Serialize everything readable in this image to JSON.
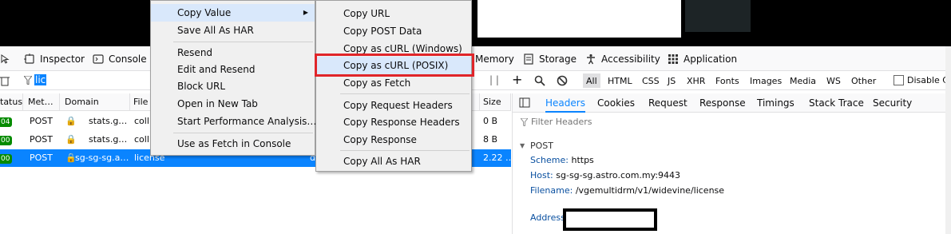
{
  "toolbar": {
    "tabs": [
      {
        "label": "Inspector",
        "icon": "inspector-icon"
      },
      {
        "label": "Console",
        "icon": "console-icon"
      },
      {
        "label": "Memory",
        "icon": "memory-icon"
      },
      {
        "label": "Storage",
        "icon": "storage-icon"
      },
      {
        "label": "Accessibility",
        "icon": "accessibility-icon"
      },
      {
        "label": "Application",
        "icon": "application-icon"
      }
    ]
  },
  "filter": {
    "value": "lic",
    "types": [
      "All",
      "HTML",
      "CSS",
      "JS",
      "XHR",
      "Fonts",
      "Images",
      "Media",
      "WS",
      "Other"
    ],
    "active_type": "All",
    "disable_cache_label": "Disable Ca"
  },
  "table": {
    "columns": [
      "tatus",
      "Met…",
      "Domain",
      "File",
      "Size"
    ],
    "rows": [
      {
        "status": "04",
        "method": "POST",
        "domain": "stats.g…",
        "file": "coll",
        "size": "0 B"
      },
      {
        "status": "00",
        "method": "POST",
        "domain": "stats.g…",
        "file": "coll",
        "size": "8 B"
      },
      {
        "status": "00",
        "method": "POST",
        "domain": "sg-sg-sg.a…",
        "file": "license",
        "extra": "d",
        "size": "2.22 …"
      }
    ]
  },
  "panel": {
    "tabs": [
      "Headers",
      "Cookies",
      "Request",
      "Response",
      "Timings",
      "Stack Trace",
      "Security"
    ],
    "active_tab": "Headers",
    "filter_placeholder": "Filter Headers",
    "section": "POST",
    "scheme_label": "Scheme:",
    "scheme_value": "https",
    "host_label": "Host:",
    "host_value": "sg-sg-sg.astro.com.my:9443",
    "filename_label": "Filename:",
    "filename_value": "/vgemultidrm/v1/widevine/license",
    "address_label": "Address"
  },
  "menu_main": {
    "items": [
      "Copy Value",
      "Save All As HAR",
      "Resend",
      "Edit and Resend",
      "Block URL",
      "Open in New Tab",
      "Start Performance Analysis…",
      "Use as Fetch in Console"
    ]
  },
  "menu_sub": {
    "items": [
      "Copy URL",
      "Copy POST Data",
      "Copy as cURL (Windows)",
      "Copy as cURL (POSIX)",
      "Copy as Fetch",
      "Copy Request Headers",
      "Copy Response Headers",
      "Copy Response",
      "Copy All As HAR"
    ],
    "highlighted": "Copy as cURL (POSIX)"
  },
  "colors": {
    "accent": "#0a84ff",
    "highlight_box": "#e0252a",
    "status_ok": "#058b00"
  }
}
